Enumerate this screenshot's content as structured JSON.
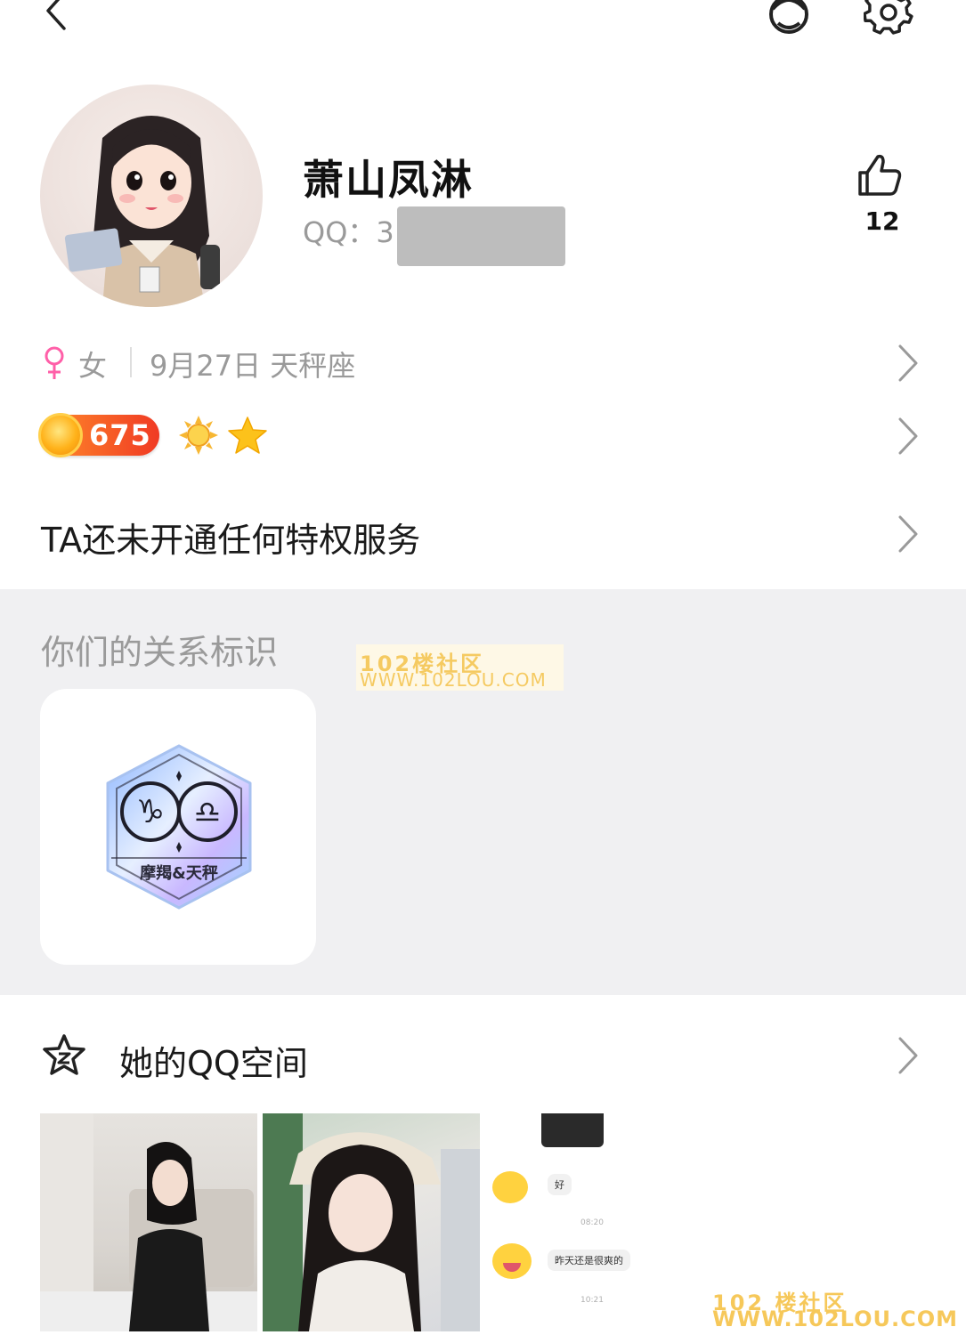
{
  "profile": {
    "nickname": "萧山凤淋",
    "qq_label": "QQ：3",
    "likes": "12"
  },
  "info": {
    "gender": "女",
    "birthday": "9月27日 天秤座"
  },
  "level": {
    "value": "675"
  },
  "privilege": {
    "text": "TA还未开通任何特权服务"
  },
  "relation": {
    "title": "你们的关系标识",
    "badge_label": "摩羯&天秤"
  },
  "watermark": {
    "line1": "102楼社区",
    "line2": "WWW.102LOU.COM",
    "bottom_line1": "102 楼社区",
    "bottom_line2": "WWW.102LOU.COM"
  },
  "qzone": {
    "title": "她的QQ空间",
    "chat": {
      "msg1": "好",
      "time1": "08:20",
      "msg2": "昨天还是很爽的",
      "time2": "10:21"
    }
  },
  "icons": {
    "back": "back-arrow-icon",
    "outfit": "outfit-icon",
    "settings": "gear-icon",
    "like": "thumbs-up-icon",
    "female": "female-icon",
    "chevron": "chevron-right-icon",
    "sun": "sun-icon",
    "star": "star-icon",
    "qzone": "qzone-star-icon"
  },
  "colors": {
    "accent_level": "#f03a24",
    "gender_pink": "#ff5fa8",
    "gray_bg": "#f0f0f2",
    "watermark": "#f6c85a"
  }
}
